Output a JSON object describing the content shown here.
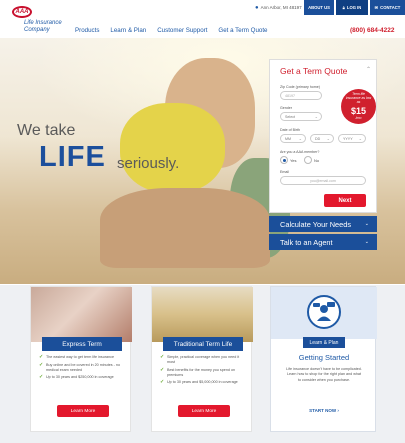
{
  "utility": {
    "location": "Ann Arbor, MI 48197",
    "about": "ABOUT US",
    "login": "LOG IN",
    "contact": "CONTACT"
  },
  "logo": {
    "mark": "AAA",
    "line1": "Life Insurance",
    "line2": "Company"
  },
  "nav": [
    "Products",
    "Learn & Plan",
    "Customer Support",
    "Get a Term Quote"
  ],
  "phone": "(800) 684-4222",
  "hero": {
    "line1": "We take",
    "line2": "LIFE",
    "line3": "seriously."
  },
  "quote": {
    "title": "Get a Term Quote",
    "zip_label": "Zip Code (primary home)",
    "zip_value": "48197",
    "gender_label": "Gender",
    "gender_value": "Select",
    "dob_label": "Date of Birth",
    "mm": "MM",
    "dd": "DD",
    "yyyy": "YYYY",
    "member_label": "Are you a AAA member?",
    "yes": "Yes",
    "no": "No",
    "email_label": "Email",
    "email_placeholder": "you@email.com",
    "next": "Next",
    "badge_line1": "Term life insurance as low as",
    "badge_price": "$15",
    "badge_line3": "/mo"
  },
  "tabs": {
    "calc": "Calculate Your Needs",
    "agent": "Talk to an Agent"
  },
  "cards": [
    {
      "title": "Express Term",
      "bullets": [
        "The easiest way to get term life insurance",
        "Buy online and be covered in 20 minutes - no medical exam needed",
        "Up to 30 years and $250,000 in coverage"
      ],
      "button": "Learn More"
    },
    {
      "title": "Traditional Term Life",
      "bullets": [
        "Simple, practical coverage when you need it most",
        "Best benefits for the money you spend on premiums",
        "Up to 30 years and $5,000,000 in coverage"
      ],
      "button": "Learn More"
    }
  ],
  "getting_started": {
    "tag": "Learn & Plan",
    "title": "Getting Started",
    "desc": "Life insurance doesn't have to be complicated. Learn how to shop for the right plan and what to consider when you purchase.",
    "link": "START NOW"
  },
  "colors": {
    "brand_blue": "#1b4f9a",
    "brand_red": "#e3182d",
    "check_green": "#6cab35"
  }
}
